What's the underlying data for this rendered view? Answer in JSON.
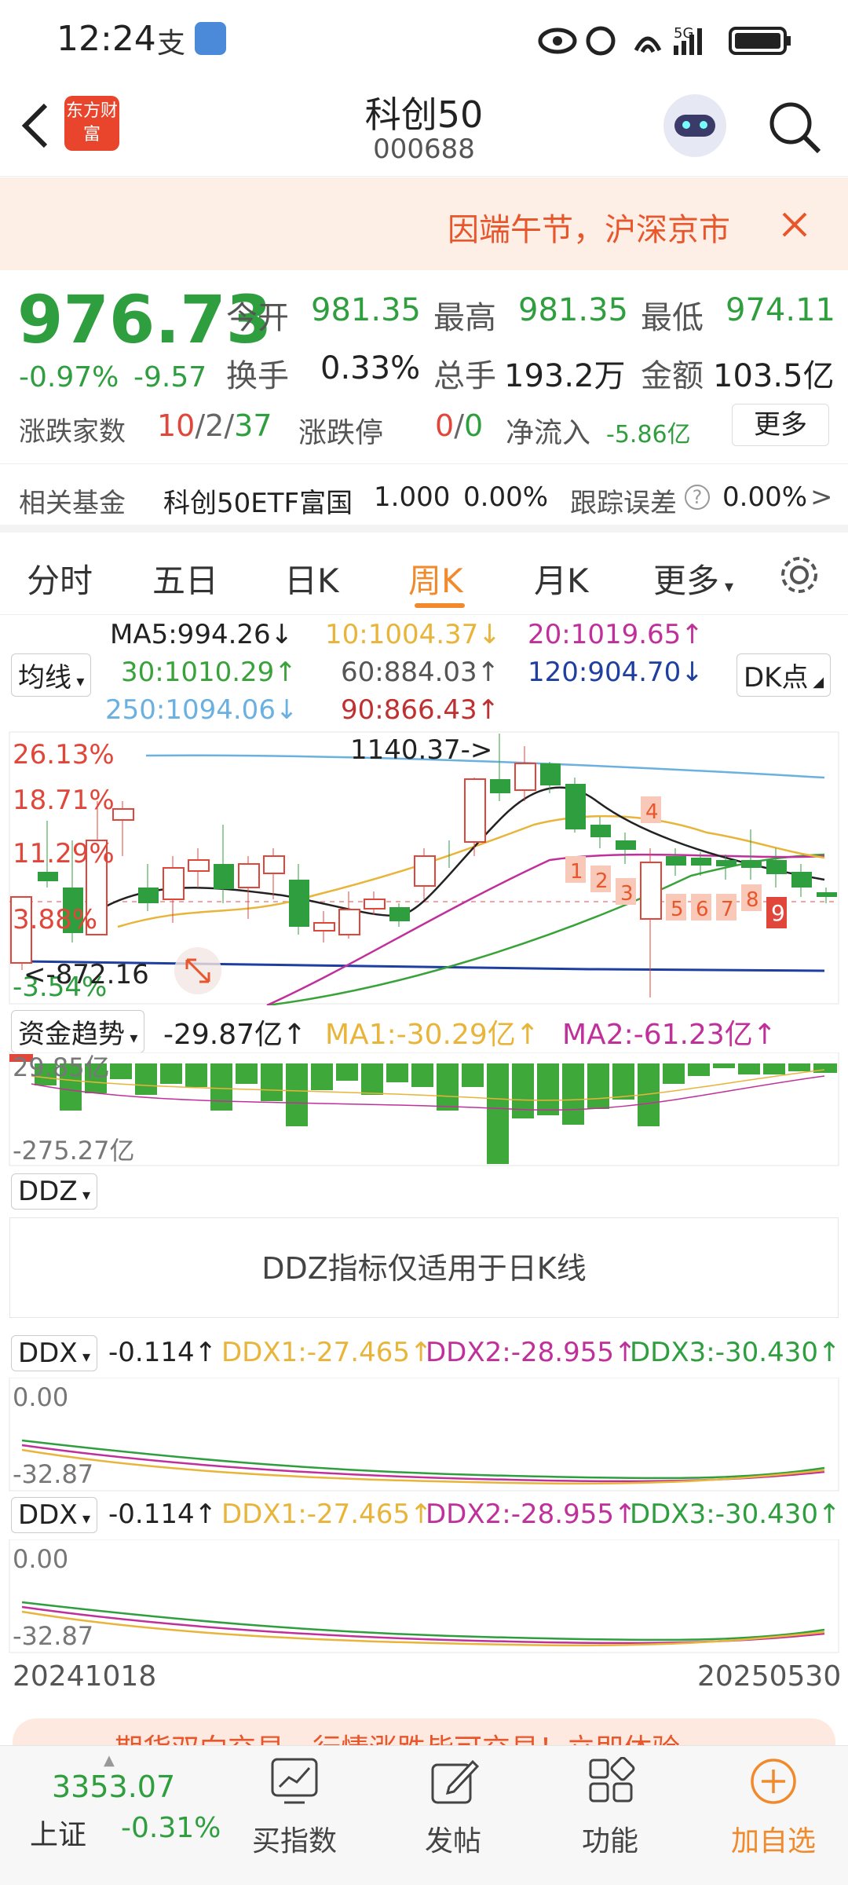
{
  "status": {
    "time": "12:24",
    "signal": "5G"
  },
  "nav": {
    "title": "科创50",
    "code": "000688",
    "logo_text": "东方财富"
  },
  "banner": {
    "text": "因端午节，沪深京市"
  },
  "quote": {
    "price": "976.73",
    "change_pct": "-0.97%",
    "change": "-9.57",
    "open_label": "今开",
    "open": "981.35",
    "high_label": "最高",
    "high": "981.35",
    "low_label": "最低",
    "low": "974.11",
    "turnover_label": "换手",
    "turnover": "0.33%",
    "volume_label": "总手",
    "volume": "193.2万",
    "amount_label": "金额",
    "amount": "103.5亿",
    "breadth_label": "涨跌家数",
    "breadth_up": "10",
    "breadth_flat": "/2/",
    "breadth_down": "37",
    "limit_label": "涨跌停",
    "limit_up": "0",
    "limit_sep": "/",
    "limit_down": "0",
    "netflow_label": "净流入",
    "netflow": "-5.86亿",
    "more_button": "更多"
  },
  "fund": {
    "label": "相关基金",
    "name": "科创50ETF富国",
    "price": "1.000",
    "pct": "0.00%",
    "error_label": "跟踪误差",
    "error": "0.00%",
    "arrow": ">"
  },
  "tabs": [
    "分时",
    "五日",
    "日K",
    "周K",
    "月K",
    "更多"
  ],
  "ma": {
    "selector": "均线",
    "ma5": "MA5:994.26↓",
    "ma10": "10:1004.37↓",
    "ma20": "20:1019.65↑",
    "ma30": "30:1010.29↑",
    "ma60": "60:884.03↑",
    "ma120": "120:904.70↓",
    "ma250": "250:1094.06↓",
    "ma90": "90:866.43↑",
    "dk_button": "DK点"
  },
  "kchart": {
    "pct_labels": [
      "26.13%",
      "18.71%",
      "11.29%",
      "3.88%",
      "-3.54%"
    ],
    "high_marker": "1140.37->",
    "low_marker": "<-872.16",
    "signals": [
      "1",
      "2",
      "3",
      "4",
      "5",
      "6",
      "7",
      "8",
      "9"
    ]
  },
  "capital": {
    "selector": "资金趋势",
    "value": "-29.87亿↑",
    "ma1": "MA1:-30.29亿↑",
    "ma2": "MA2:-61.23亿↑",
    "top_label": "29.85亿",
    "bottom_label": "-275.27亿"
  },
  "ddz": {
    "selector": "DDZ",
    "message": "DDZ指标仅适用于日K线"
  },
  "ddx_panels": [
    {
      "selector": "DDX",
      "value": "-0.114↑",
      "ddx1": "DDX1:-27.465↑",
      "ddx2": "DDX2:-28.955↑",
      "ddx3": "DDX3:-30.430↑",
      "top": "0.00",
      "bottom": "-32.87"
    },
    {
      "selector": "DDX",
      "value": "-0.114↑",
      "ddx1": "DDX1:-27.465↑",
      "ddx2": "DDX2:-28.955↑",
      "ddx3": "DDX3:-30.430↑",
      "top": "0.00",
      "bottom": "-32.87"
    }
  ],
  "dates": {
    "start": "20241018",
    "end": "20250530"
  },
  "ad_strip": {
    "text": "期货双向交易，行情涨跌皆可交易！立即体验"
  },
  "bottom": {
    "index_value": "3353.07",
    "index_name": "上证",
    "index_pct": "-0.31%",
    "buy_index": "买指数",
    "post": "发帖",
    "function": "功能",
    "add_watch": "加自选"
  },
  "colors": {
    "accent": "#f08a2c",
    "red": "#e0463a",
    "green": "#2e9e3e",
    "ma10": "#e8b43a",
    "ma20": "#c0309a",
    "ma30": "#3aa23a",
    "ma120": "#1f3fa0",
    "ma250": "#6ab0e0",
    "ma90": "#c03030"
  }
}
